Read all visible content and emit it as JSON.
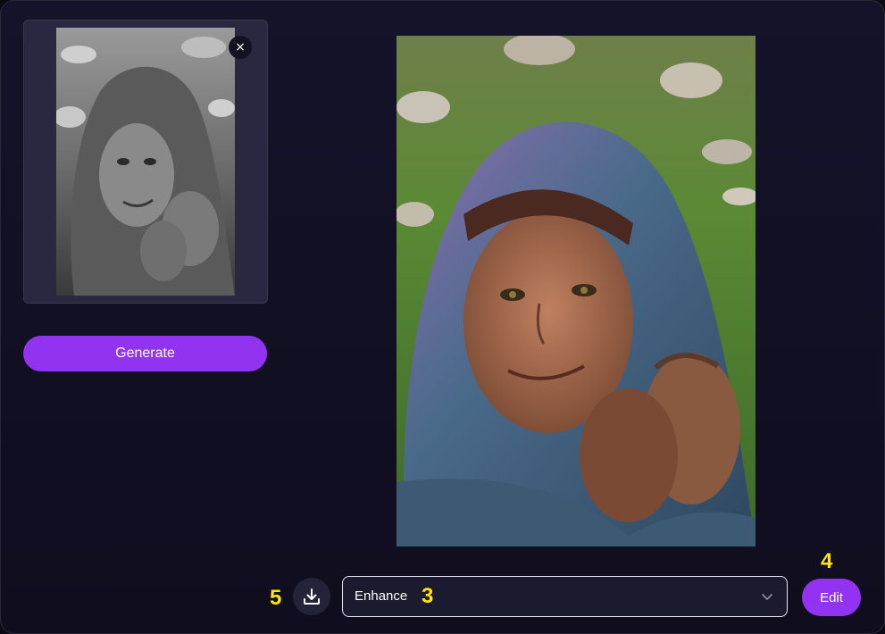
{
  "source": {
    "thumbnail_alt": "black and white portrait",
    "close_label": "×"
  },
  "actions": {
    "generate_label": "Generate",
    "edit_label": "Edit"
  },
  "mode_select": {
    "selected": "Enhance"
  },
  "annotations": {
    "marker_3": "3",
    "marker_4": "4",
    "marker_5": "5"
  },
  "icons": {
    "close": "close-icon",
    "download": "download-icon",
    "chevron": "chevron-down-icon"
  },
  "colors": {
    "accent": "#9333f2",
    "marker": "#ffe600",
    "background": "#13112a",
    "card": "#2a2740"
  }
}
